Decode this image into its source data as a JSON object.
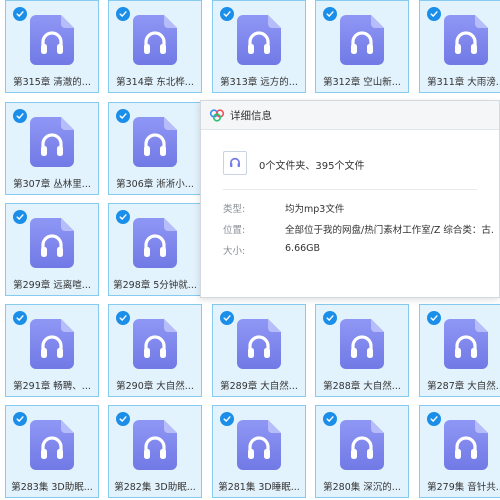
{
  "colors": {
    "tile_bg": "#e3f3fd",
    "tile_border": "#86caf0",
    "check": "#1a8ee8",
    "file_icon_top": "#8f97f5",
    "file_icon_bottom": "#7179e6"
  },
  "files": [
    {
      "name": "第315章 清澈的...",
      "icon": "headphones-icon"
    },
    {
      "name": "第314章 东北桦...",
      "icon": "headphones-icon"
    },
    {
      "name": "第313章 远方的...",
      "icon": "headphones-icon"
    },
    {
      "name": "第312章 空山新...",
      "icon": "headphones-icon"
    },
    {
      "name": "第311章 大雨滂...",
      "icon": "headphones-icon"
    },
    {
      "name": "第307章 丛林里...",
      "icon": "headphones-icon"
    },
    {
      "name": "第306章 淅淅小...",
      "icon": "headphones-icon"
    },
    {
      "name": "第299章 远离喧...",
      "icon": "headphones-icon"
    },
    {
      "name": "第298章 5分钟就...",
      "icon": "headphones-icon"
    },
    {
      "name": "第291章 畅聘、...",
      "icon": "headphones-icon"
    },
    {
      "name": "第290章 大自然...",
      "icon": "headphones-icon"
    },
    {
      "name": "第289章 大自然...",
      "icon": "headphones-icon"
    },
    {
      "name": "第288章 大自然...",
      "icon": "headphones-icon"
    },
    {
      "name": "第287章 大自然...",
      "icon": "headphones-icon"
    },
    {
      "name": "第283集 3D助眠...",
      "icon": "headphones-icon"
    },
    {
      "name": "第282集 3D助眠...",
      "icon": "headphones-icon"
    },
    {
      "name": "第281集 3D睡眠...",
      "icon": "headphones-icon"
    },
    {
      "name": "第280集 深沉的...",
      "icon": "headphones-icon"
    },
    {
      "name": "第279集 音针共...",
      "icon": "headphones-icon"
    }
  ],
  "details": {
    "title": "详细信息",
    "summary": "0个文件夹、395个文件",
    "rows": [
      {
        "label": "类型:",
        "value": "均为mp3文件"
      },
      {
        "label": "位置:",
        "value": "全部位于我的网盘/热门素材工作室/Z 综合类：古..."
      },
      {
        "label": "大小:",
        "value": "6.66GB"
      }
    ]
  }
}
